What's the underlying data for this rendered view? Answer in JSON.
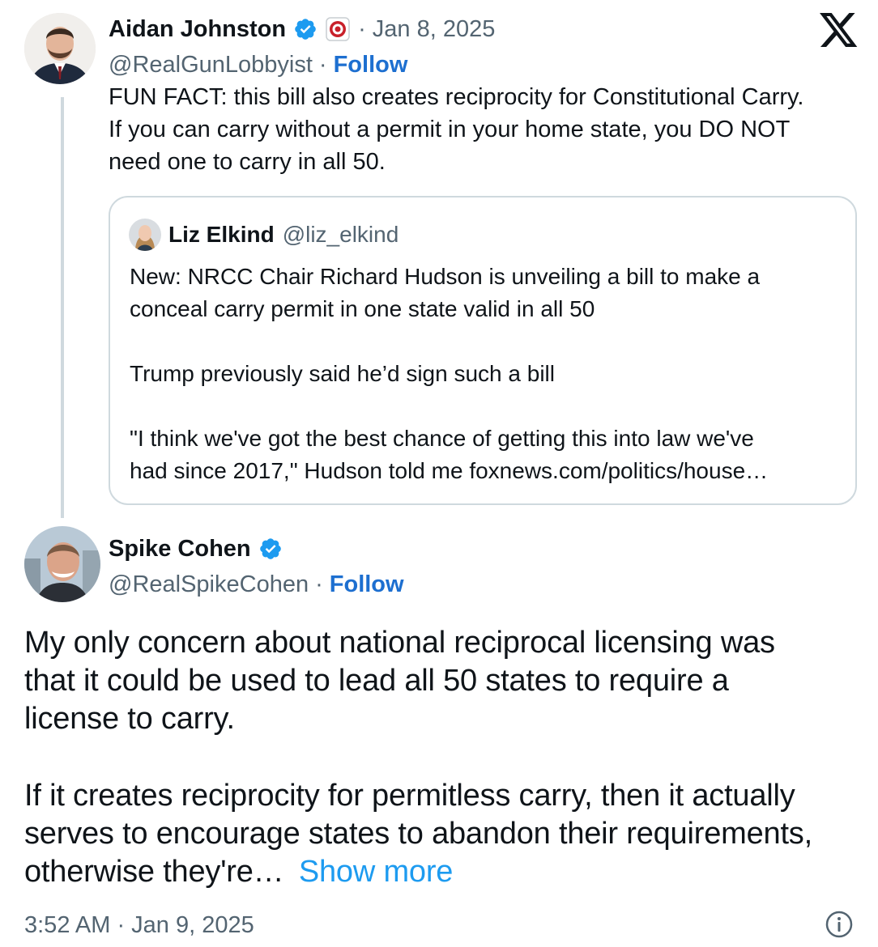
{
  "tweet1": {
    "author_name": "Aidan Johnston",
    "handle": "@RealGunLobbyist",
    "separator": "·",
    "date_sep": "·",
    "date": "Jan 8, 2025",
    "follow_label": "Follow",
    "text_lines": [
      "FUN FACT: this bill also creates reciprocity for Constitutional Carry.",
      "If you can carry without a permit in your home state, you DO NOT",
      "need one to carry in all 50."
    ]
  },
  "quote": {
    "author_name": "Liz Elkind",
    "handle": "@liz_elkind",
    "text_lines": [
      "New: NRCC Chair Richard Hudson is unveiling a bill to make a",
      "conceal carry permit in one state valid in all 50",
      "Trump previously said he’d sign such a bill",
      "\"I think we've got the best chance of getting this into law we've",
      "had since 2017,\" Hudson told me foxnews.com/politics/house…"
    ]
  },
  "tweet2": {
    "author_name": "Spike Cohen",
    "handle": "@RealSpikeCohen",
    "separator": "·",
    "follow_label": "Follow",
    "text_lines": [
      "My only concern about national reciprocal licensing was",
      "that it could be used to lead all 50 states to require a",
      "license to carry.",
      "If it creates reciprocity for permitless carry, then it actually",
      "serves to encourage states to abandon their requirements,",
      "otherwise they're…"
    ],
    "show_more": "Show more",
    "timestamp": "3:52 AM · Jan 9, 2025"
  },
  "icons": {
    "verified": "verified-badge-icon",
    "org_badge": "org-affiliation-badge-icon",
    "brand": "x-logo-icon",
    "info": "info-icon"
  },
  "colors": {
    "link": "#1d6fd0",
    "show_more": "#1d9bf0",
    "verified": "#1d9bf0",
    "muted": "#536471",
    "border": "#cfd9de"
  }
}
